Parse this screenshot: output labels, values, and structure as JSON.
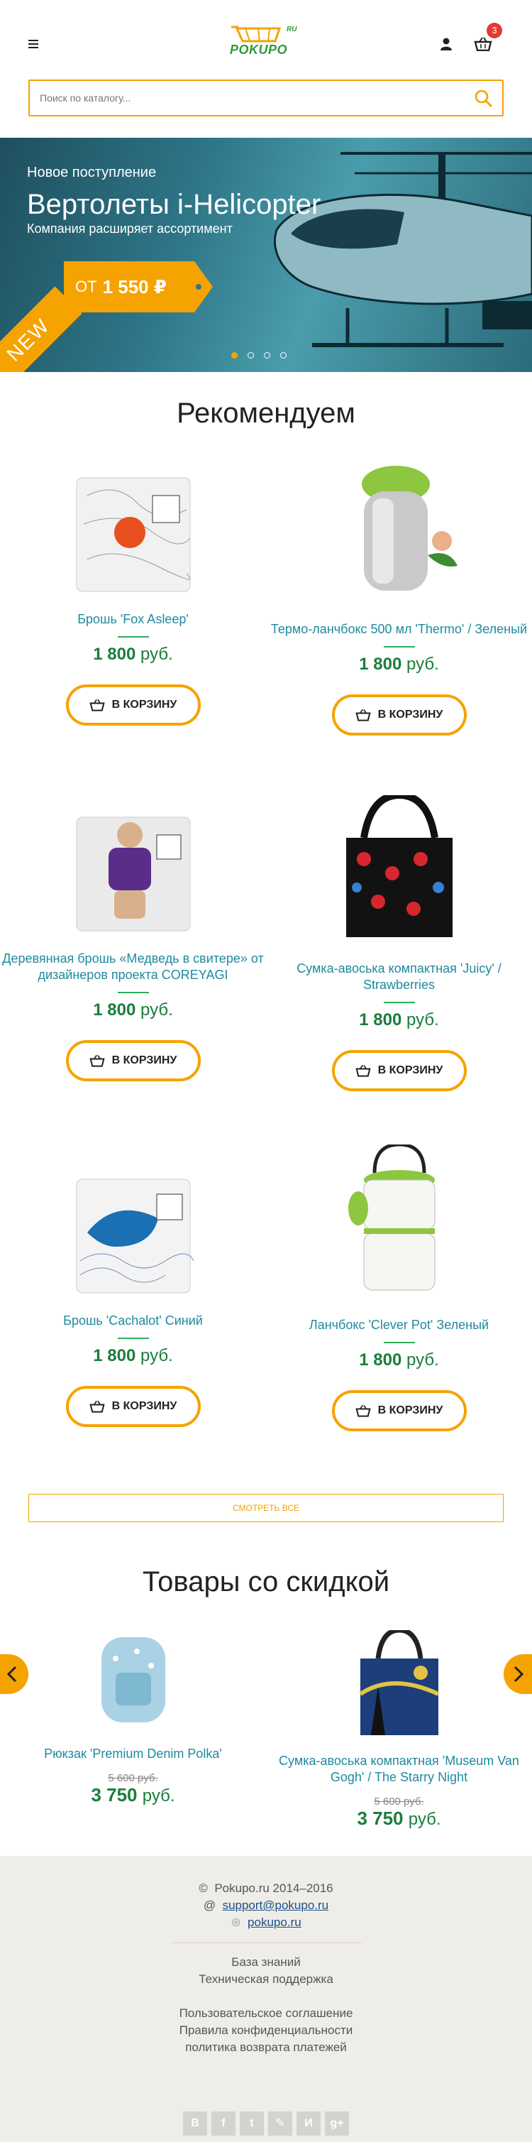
{
  "header": {
    "logo_text": "POKUPO",
    "logo_suffix": "RU",
    "cart_count": "3"
  },
  "search": {
    "placeholder": "Поиск по каталогу..."
  },
  "hero": {
    "eyebrow": "Новое поступление",
    "title": "Вертолеты i-Helicopter",
    "subtitle": "Компания расширяет ассортимент",
    "price_prefix": "от",
    "price": "1 550 ₽",
    "ribbon": "NEW",
    "slides": 4,
    "active_slide": 1
  },
  "recommended": {
    "title": "Рекомендуем",
    "cart_button": "В КОРЗИНУ",
    "currency": "руб.",
    "products": [
      {
        "name": "Брошь 'Fox Asleep'",
        "price": "1 800"
      },
      {
        "name": "Термо-ланчбокс 500 мл 'Thermo' / Зеленый",
        "price": "1 800"
      },
      {
        "name": "Деревянная брошь «Медведь в свитере» от дизайнеров проекта COREYAGI",
        "price": "1 800"
      },
      {
        "name": "Сумка-авоська компактная 'Juicy' / Strawberries",
        "price": "1 800"
      },
      {
        "name": "Брошь 'Cachalot' Синий",
        "price": "1 800"
      },
      {
        "name": "Ланчбокс 'Clever Pot' Зеленый",
        "price": "1 800"
      }
    ],
    "see_all": "СМОТРЕТЬ ВСЕ"
  },
  "discount": {
    "title": "Товары со скидкой",
    "products": [
      {
        "name": "Рюкзак 'Premium Denim Polka'",
        "old_price": "5 600 руб.",
        "price": "3 750"
      },
      {
        "name": "Сумка-авоська компактная 'Museum Van Gogh' / The Starry Night",
        "old_price": "5 600 руб.",
        "price": "3 750"
      }
    ]
  },
  "footer": {
    "copyright": "Pokupo.ru 2014–2016",
    "email": "support@pokupo.ru",
    "skype": "pokupo.ru",
    "links": [
      "База знаний",
      "Техническая поддержка",
      "Пользовательское соглашение",
      "Правила конфиденциальности",
      "политика возврата платежей"
    ],
    "social": [
      "В",
      "f",
      "t",
      "✎",
      "И",
      "g+"
    ]
  },
  "colors": {
    "accent": "#f5a300",
    "link": "#1e8a9e",
    "price": "#1a7e3c",
    "badge": "#e53935"
  }
}
